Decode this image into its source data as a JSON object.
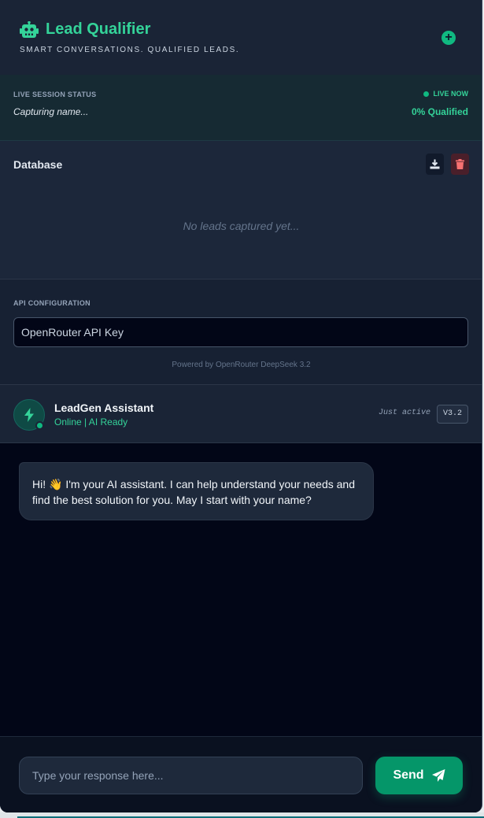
{
  "header": {
    "title": "Lead Qualifier",
    "subtitle": "SMART CONVERSATIONS. QUALIFIED LEADS.",
    "new_session_icon": "plus-circle-icon",
    "new_session_label": "+"
  },
  "session": {
    "label": "LIVE SESSION STATUS",
    "live_label": "LIVE NOW",
    "status_text": "Capturing name...",
    "qualified_text": "0% Qualified"
  },
  "database": {
    "title": "Database",
    "empty_text": "No leads captured yet...",
    "download_icon": "download-icon",
    "delete_icon": "trash-icon"
  },
  "api": {
    "label": "API CONFIGURATION",
    "placeholder": "OpenRouter API Key",
    "powered_by": "Powered by OpenRouter DeepSeek 3.2"
  },
  "assistant": {
    "name": "LeadGen Assistant",
    "status": "Online | AI Ready",
    "last_active": "Just active",
    "version": "V3.2",
    "avatar_icon": "bolt-icon"
  },
  "chat": {
    "messages": [
      {
        "role": "assistant",
        "text": "Hi! 👋 I'm your AI assistant. I can help understand your needs and find the best solution for you. May I start with your name?"
      }
    ]
  },
  "composer": {
    "placeholder": "Type your response here...",
    "send_label": "Send",
    "send_icon": "paper-plane-icon"
  },
  "colors": {
    "accent": "#34d399",
    "accent_dark": "#059669",
    "background": "#020617",
    "danger": "#ef4444"
  }
}
